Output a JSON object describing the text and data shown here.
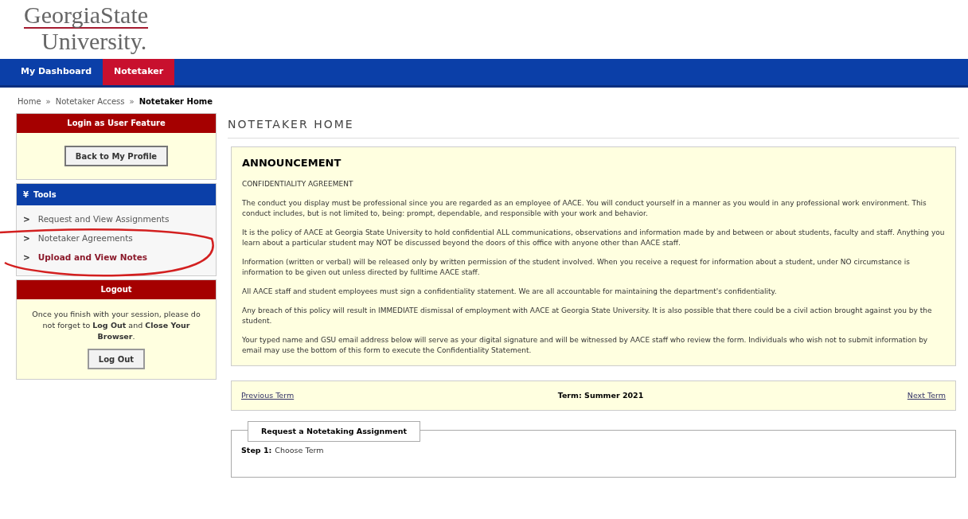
{
  "logo": {
    "line1": "GeorgiaState",
    "line2": "University."
  },
  "nav": [
    {
      "label": "My Dashboard",
      "selected": false
    },
    {
      "label": "Notetaker",
      "selected": true
    }
  ],
  "breadcrumb": [
    {
      "label": "Home",
      "current": false
    },
    {
      "label": "Notetaker Access",
      "current": false
    },
    {
      "label": "Notetaker Home",
      "current": true
    }
  ],
  "breadcrumb_separator": "»",
  "login_panel": {
    "title": "Login as User Feature",
    "button": "Back to My Profile"
  },
  "tools_panel": {
    "icon": "¥",
    "title": "Tools",
    "items": [
      {
        "label": "Request and View Assignments",
        "selected": false
      },
      {
        "label": "Notetaker Agreements",
        "selected": false
      },
      {
        "label": "Upload and View Notes",
        "selected": true
      }
    ],
    "marker": ">"
  },
  "logout_panel": {
    "title": "Logout",
    "text": "Once you finish with your session, please do not forget to **Log Out** and **Close Your Browser**.",
    "button": "Log Out"
  },
  "page_title": "NOTETAKER HOME",
  "announcement": {
    "title": "ANNOUNCEMENT",
    "subtitle": "CONFIDENTIALITY AGREEMENT",
    "paragraphs": [
      "The conduct you display must be professional since you are regarded as an employee of AACE. You will conduct yourself in a manner as you would in any professional work environment. This conduct includes, but is not limited to, being: prompt, dependable, and responsible with your work and behavior.",
      "It is the policy of AACE at Georgia State University to hold confidential ALL communications, observations and information made by and between or about students, faculty and staff. Anything you learn about a particular student may NOT be discussed beyond the doors of this office with anyone other than AACE staff.",
      "Information (written or verbal) will be released only by written permission of the student involved. When you receive a request for information about a student, under NO circumstance is information to be given out unless directed by fulltime AACE staff.",
      "All AACE staff and student employees must sign a confidentiality statement. We are all accountable for maintaining the department's confidentiality.",
      "Any breach of this policy will result in IMMEDIATE dismissal of employment with AACE at Georgia State University. It is also possible that there could be a civil action brought against you by the student.",
      "Your typed name and GSU email address below will serve as your digital signature and will be witnessed by AACE staff who review the form. Individuals who wish not to submit information by email may use the bottom of this form to execute the Confidentiality Statement."
    ]
  },
  "term_bar": {
    "previous": "Previous Term",
    "term": "Term: Summer 2021",
    "next": "Next Term"
  },
  "request": {
    "legend": "Request a Notetaking Assignment",
    "step_label": "Step 1:",
    "step_text": "Choose Term"
  }
}
